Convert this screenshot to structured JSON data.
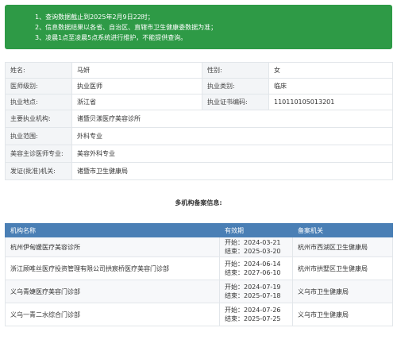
{
  "notice": {
    "lines": [
      "1、查询数据截止到2025年2月9日22时；",
      "2、信息数据结果以各省、自治区、直辖市卫生健康委数据为准；",
      "3、凌晨1点至凌晨5点系统进行维护，不能提供查询。"
    ]
  },
  "info": {
    "name_label": "姓名:",
    "name_value": "马妍",
    "gender_label": "性别:",
    "gender_value": "女",
    "level_label": "医师级别:",
    "level_value": "执业医师",
    "category_label": "执业类别:",
    "category_value": "临床",
    "place_label": "执业地点:",
    "place_value": "浙江省",
    "cert_label": "执业证书编码:",
    "cert_value": "110110105013201",
    "org_label": "主要执业机构:",
    "org_value": "诸暨贝漾医疗美容诊所",
    "scope_label": "执业范围:",
    "scope_value": "外科专业",
    "cosmetic_label": "美容主诊医师专业:",
    "cosmetic_value": "美容外科专业",
    "issuer_label": "发证(批准)机关:",
    "issuer_value": "诸暨市卫生健康局"
  },
  "multi": {
    "title": "多机构备案信息:",
    "headers": [
      "机构名称",
      "有效期",
      "备案机关"
    ],
    "start_prefix": "开始：",
    "end_prefix": "结束：",
    "rows": [
      {
        "org": "杭州伊甸媛医疗美容诊所",
        "start": "2024-03-21",
        "end": "2025-03-20",
        "authority": "杭州市西湖区卫生健康局"
      },
      {
        "org": "浙江顾唯丝医疗投资管理有限公司拱宸桥医疗美容门诊部",
        "start": "2024-06-14",
        "end": "2027-06-10",
        "authority": "杭州市拱墅区卫生健康局"
      },
      {
        "org": "义乌青婕医疗美容门诊部",
        "start": "2024-07-19",
        "end": "2025-07-18",
        "authority": "义乌市卫生健康局"
      },
      {
        "org": "义乌一青二水综合门诊部",
        "start": "2024-07-26",
        "end": "2025-07-25",
        "authority": "义乌市卫生健康局"
      }
    ]
  }
}
